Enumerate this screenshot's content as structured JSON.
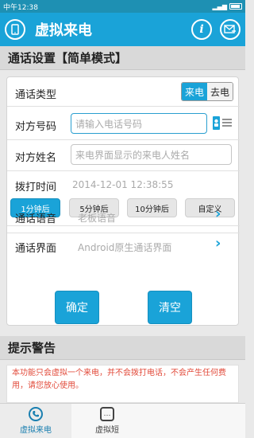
{
  "status_bar": {
    "time": "中午12:38"
  },
  "app_bar": {
    "title": "虚拟来电",
    "info_icon": "i"
  },
  "settings": {
    "heading": "通话设置【简单模式】",
    "call_type": {
      "label": "通话类型",
      "options": [
        "来电",
        "去电"
      ],
      "selected": "来电"
    },
    "number": {
      "label": "对方号码",
      "placeholder": "请输入电话号码"
    },
    "name": {
      "label": "对方姓名",
      "placeholder": "来电界面显示的来电人姓名"
    },
    "dial_time": {
      "label": "拨打时间",
      "value": "2014-12-01 12:38:55"
    },
    "delays": [
      "1分钟后",
      "5分钟后",
      "10分钟后",
      "自定义"
    ],
    "voice": {
      "label": "通话语音",
      "value": "老板语音"
    },
    "ui": {
      "label": "通话界面",
      "value": "Android原生通话界面"
    },
    "confirm_label": "确定",
    "clear_label": "清空"
  },
  "warning": {
    "heading": "提示警告",
    "text": "本功能只会虚拟一个来电，并不会拨打电话，不会产生任何费用，请您放心使用。"
  },
  "bottom_nav": [
    {
      "label": "虚拟来电",
      "icon": "phone-icon"
    },
    {
      "label": "虚拟短",
      "icon": "message-icon"
    }
  ],
  "colors": {
    "accent": "#1aa3d8",
    "warning": "#e24b3b"
  }
}
